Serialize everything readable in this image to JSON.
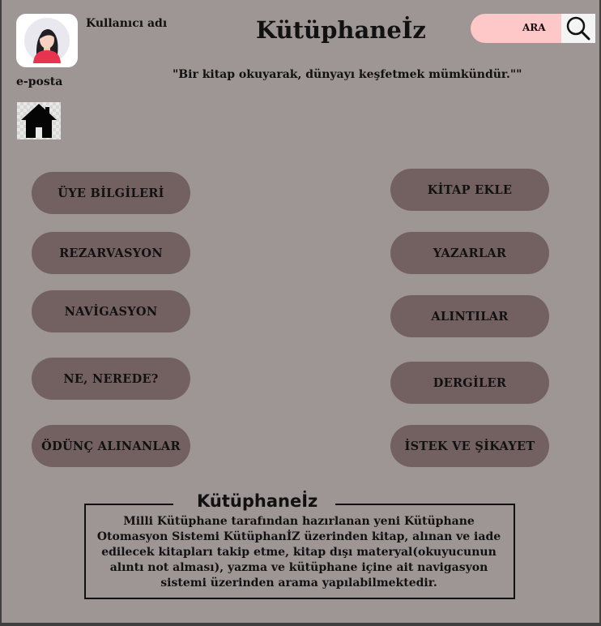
{
  "header": {
    "username_label": "Kullanıcı adı",
    "email_label": "e-posta",
    "app_title": "Kütüphaneİz",
    "search_label": "ARA",
    "quote": "\"Bir kitap okuyarak, dünyayı keşfetmek mümkündür.\"\""
  },
  "icons": {
    "avatar": "user-avatar-icon",
    "search": "magnifier-icon",
    "home": "home-icon"
  },
  "menu": {
    "left": [
      {
        "label": "ÜYE BİLGİLERİ"
      },
      {
        "label": "REZARVASYON"
      },
      {
        "label": "NAVİGASYON"
      },
      {
        "label": "NE, NEREDE?"
      },
      {
        "label": "ÖDÜNÇ ALINANLAR"
      }
    ],
    "right": [
      {
        "label": "KİTAP EKLE"
      },
      {
        "label": "YAZARLAR"
      },
      {
        "label": "ALINTILAR"
      },
      {
        "label": "DERGİLER"
      },
      {
        "label": "İSTEK VE ŞİKAYET"
      }
    ]
  },
  "info": {
    "title": "Kütüphaneİz",
    "lines": [
      "Milli Kütüphane tarafından hazırlanan yeni Kütüphane",
      "Otomasyon Sistemi KütüphanİZ üzerinden kitap, alınan ve iade",
      "edilecek kitapları takip etme, kitap dışı materyal(okuyucunun",
      "alıntı not alması), yazma ve kütüphane içine ait navigasyon",
      "sistemi üzerinden arama yapılabilmektedir."
    ]
  },
  "colors": {
    "background": "#9e9595",
    "button": "#736161",
    "search_pill": "#ffc8c8"
  }
}
